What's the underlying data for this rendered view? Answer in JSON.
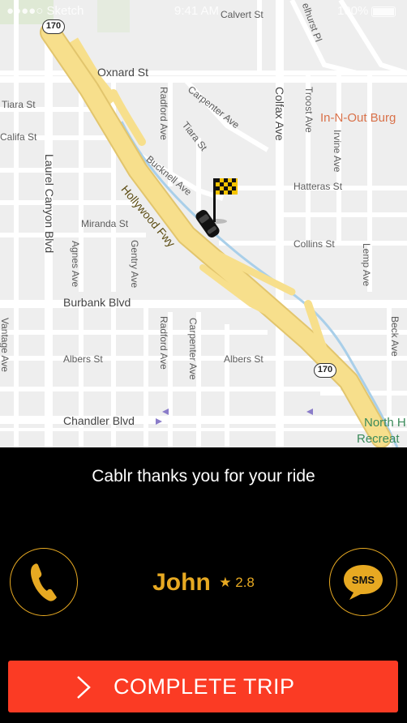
{
  "status_bar": {
    "carrier": "●●●●○ Sketch",
    "time": "9:41 AM",
    "battery": "100%"
  },
  "map": {
    "streets": {
      "oxnard": "Oxnard St",
      "calvert": "Calvert St",
      "kelhurst": "elhurst Pl",
      "tiara_left": "Tiara St",
      "califa": "Califa St",
      "radford_top": "Radford Ave",
      "carpenter_top": "Carpenter Ave",
      "tiara_mid": "Tiara St",
      "colfax": "Colfax Ave",
      "troost": "Troost Ave",
      "irvine": "Irvine Ave",
      "bucknell": "Bucknell Ave",
      "hatteras": "Hatteras St",
      "hollywood_fwy": "Hollywood Fwy",
      "laurel_canyon": "Laurel Canyon Blvd",
      "miranda": "Miranda St",
      "agnes": "Agnes Ave",
      "gentry": "Gentry Ave",
      "collins": "Collins St",
      "lemp": "Lemp Ave",
      "burbank": "Burbank Blvd",
      "vantage": "Vantage Ave",
      "albers_left": "Albers St",
      "radford_bottom": "Radford Ave",
      "carpenter_bottom": "Carpenter Ave",
      "albers_right": "Albers St",
      "beck": "Beck Ave",
      "chandler": "Chandler Blvd"
    },
    "pois": {
      "in_n_out": "In-N-Out Burg",
      "north_recreation_1": "North H",
      "north_recreation_2": "Recreat"
    },
    "shields": {
      "top": "170",
      "bottom": "170"
    }
  },
  "panel": {
    "thanks_text": "Cablr thanks you for your ride",
    "driver_name": "John",
    "rating_star": "★",
    "rating_value": "2.8",
    "sms_label": "SMS",
    "complete_button_label": "COMPLETE TRIP"
  },
  "colors": {
    "accent": "#e7a922",
    "button": "#fb3b24",
    "background": "#000000",
    "freeway": "#f7df8c",
    "map": "#eeeeee"
  },
  "icons": {
    "call": "phone-icon",
    "sms": "sms-bubble-icon",
    "complete": "chevron-right-icon",
    "car": "car-icon",
    "flag": "checkered-flag-icon"
  }
}
